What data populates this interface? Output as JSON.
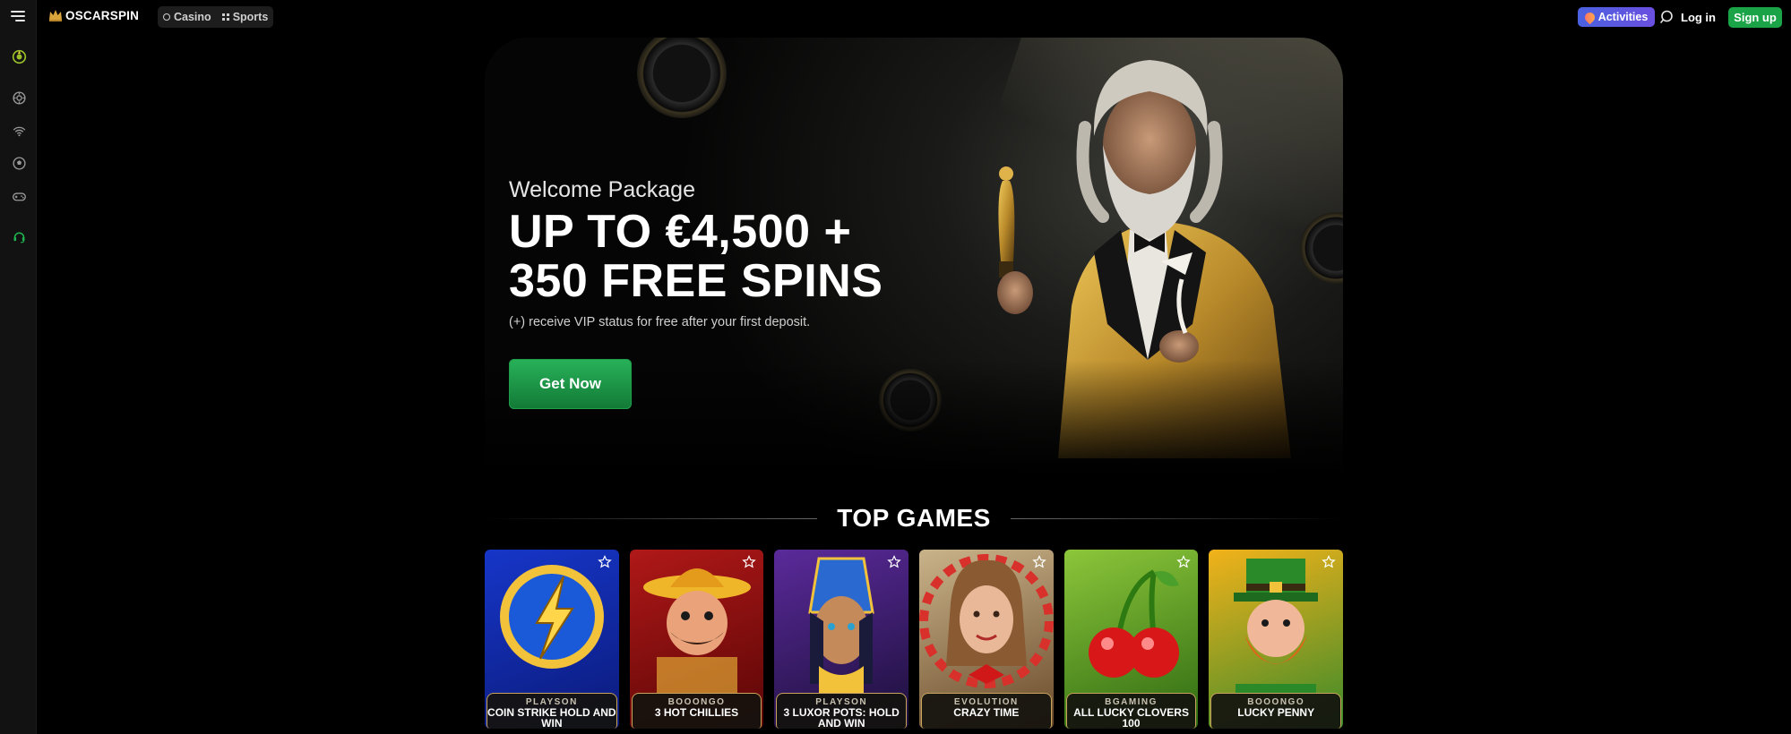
{
  "header": {
    "brand": "OSCARSPIN",
    "modes": [
      {
        "label": "Casino",
        "icon": "casino-chip-icon"
      },
      {
        "label": "Sports",
        "icon": "sports-grid-icon"
      }
    ],
    "activities_label": "Activities",
    "login_label": "Log in",
    "signup_label": "Sign up"
  },
  "sidebar": {
    "items": [
      {
        "icon": "wheel-bonus-icon",
        "color": "#9bbf2a"
      },
      {
        "icon": "casino-chip-icon",
        "color": "#9a9a9a"
      },
      {
        "icon": "live-signal-icon",
        "color": "#9a9a9a"
      },
      {
        "icon": "football-icon",
        "color": "#9a9a9a"
      },
      {
        "icon": "gamepad-icon",
        "color": "#9a9a9a"
      },
      {
        "icon": "support-headset-icon",
        "color": "#1fb44d"
      }
    ]
  },
  "hero": {
    "subtitle": "Welcome Package",
    "title_line1": "UP TO €4,500 +",
    "title_line2": "350 FREE SPINS",
    "note": "(+) receive VIP status for free after your first deposit.",
    "cta_label": "Get Now"
  },
  "top_games": {
    "title": "TOP GAMES",
    "games": [
      {
        "provider": "PLAYSON",
        "name": "COIN STRIKE HOLD AND WIN",
        "colors": [
          "#1636c8",
          "#0b1a7a"
        ]
      },
      {
        "provider": "BOOONGO",
        "name": "3 HOT CHILLIES",
        "colors": [
          "#b01818",
          "#5a0606"
        ]
      },
      {
        "provider": "PLAYSON",
        "name": "3 LUXOR POTS: HOLD AND WIN",
        "colors": [
          "#5a2a9a",
          "#1c0f3a"
        ]
      },
      {
        "provider": "EVOLUTION",
        "name": "CRAZY TIME",
        "colors": [
          "#c9b38a",
          "#6a4a2a"
        ]
      },
      {
        "provider": "BGAMING",
        "name": "ALL LUCKY CLOVERS 100",
        "colors": [
          "#8cc63a",
          "#2e6a12"
        ]
      },
      {
        "provider": "BOOONGO",
        "name": "LUCKY PENNY",
        "colors": [
          "#f2b21a",
          "#3a8a2a"
        ]
      }
    ]
  },
  "colors": {
    "brand_green": "#1aa447",
    "activities_start": "#4b62e0",
    "activities_end": "#6a4fe0",
    "label_border": "#c9a45c"
  }
}
